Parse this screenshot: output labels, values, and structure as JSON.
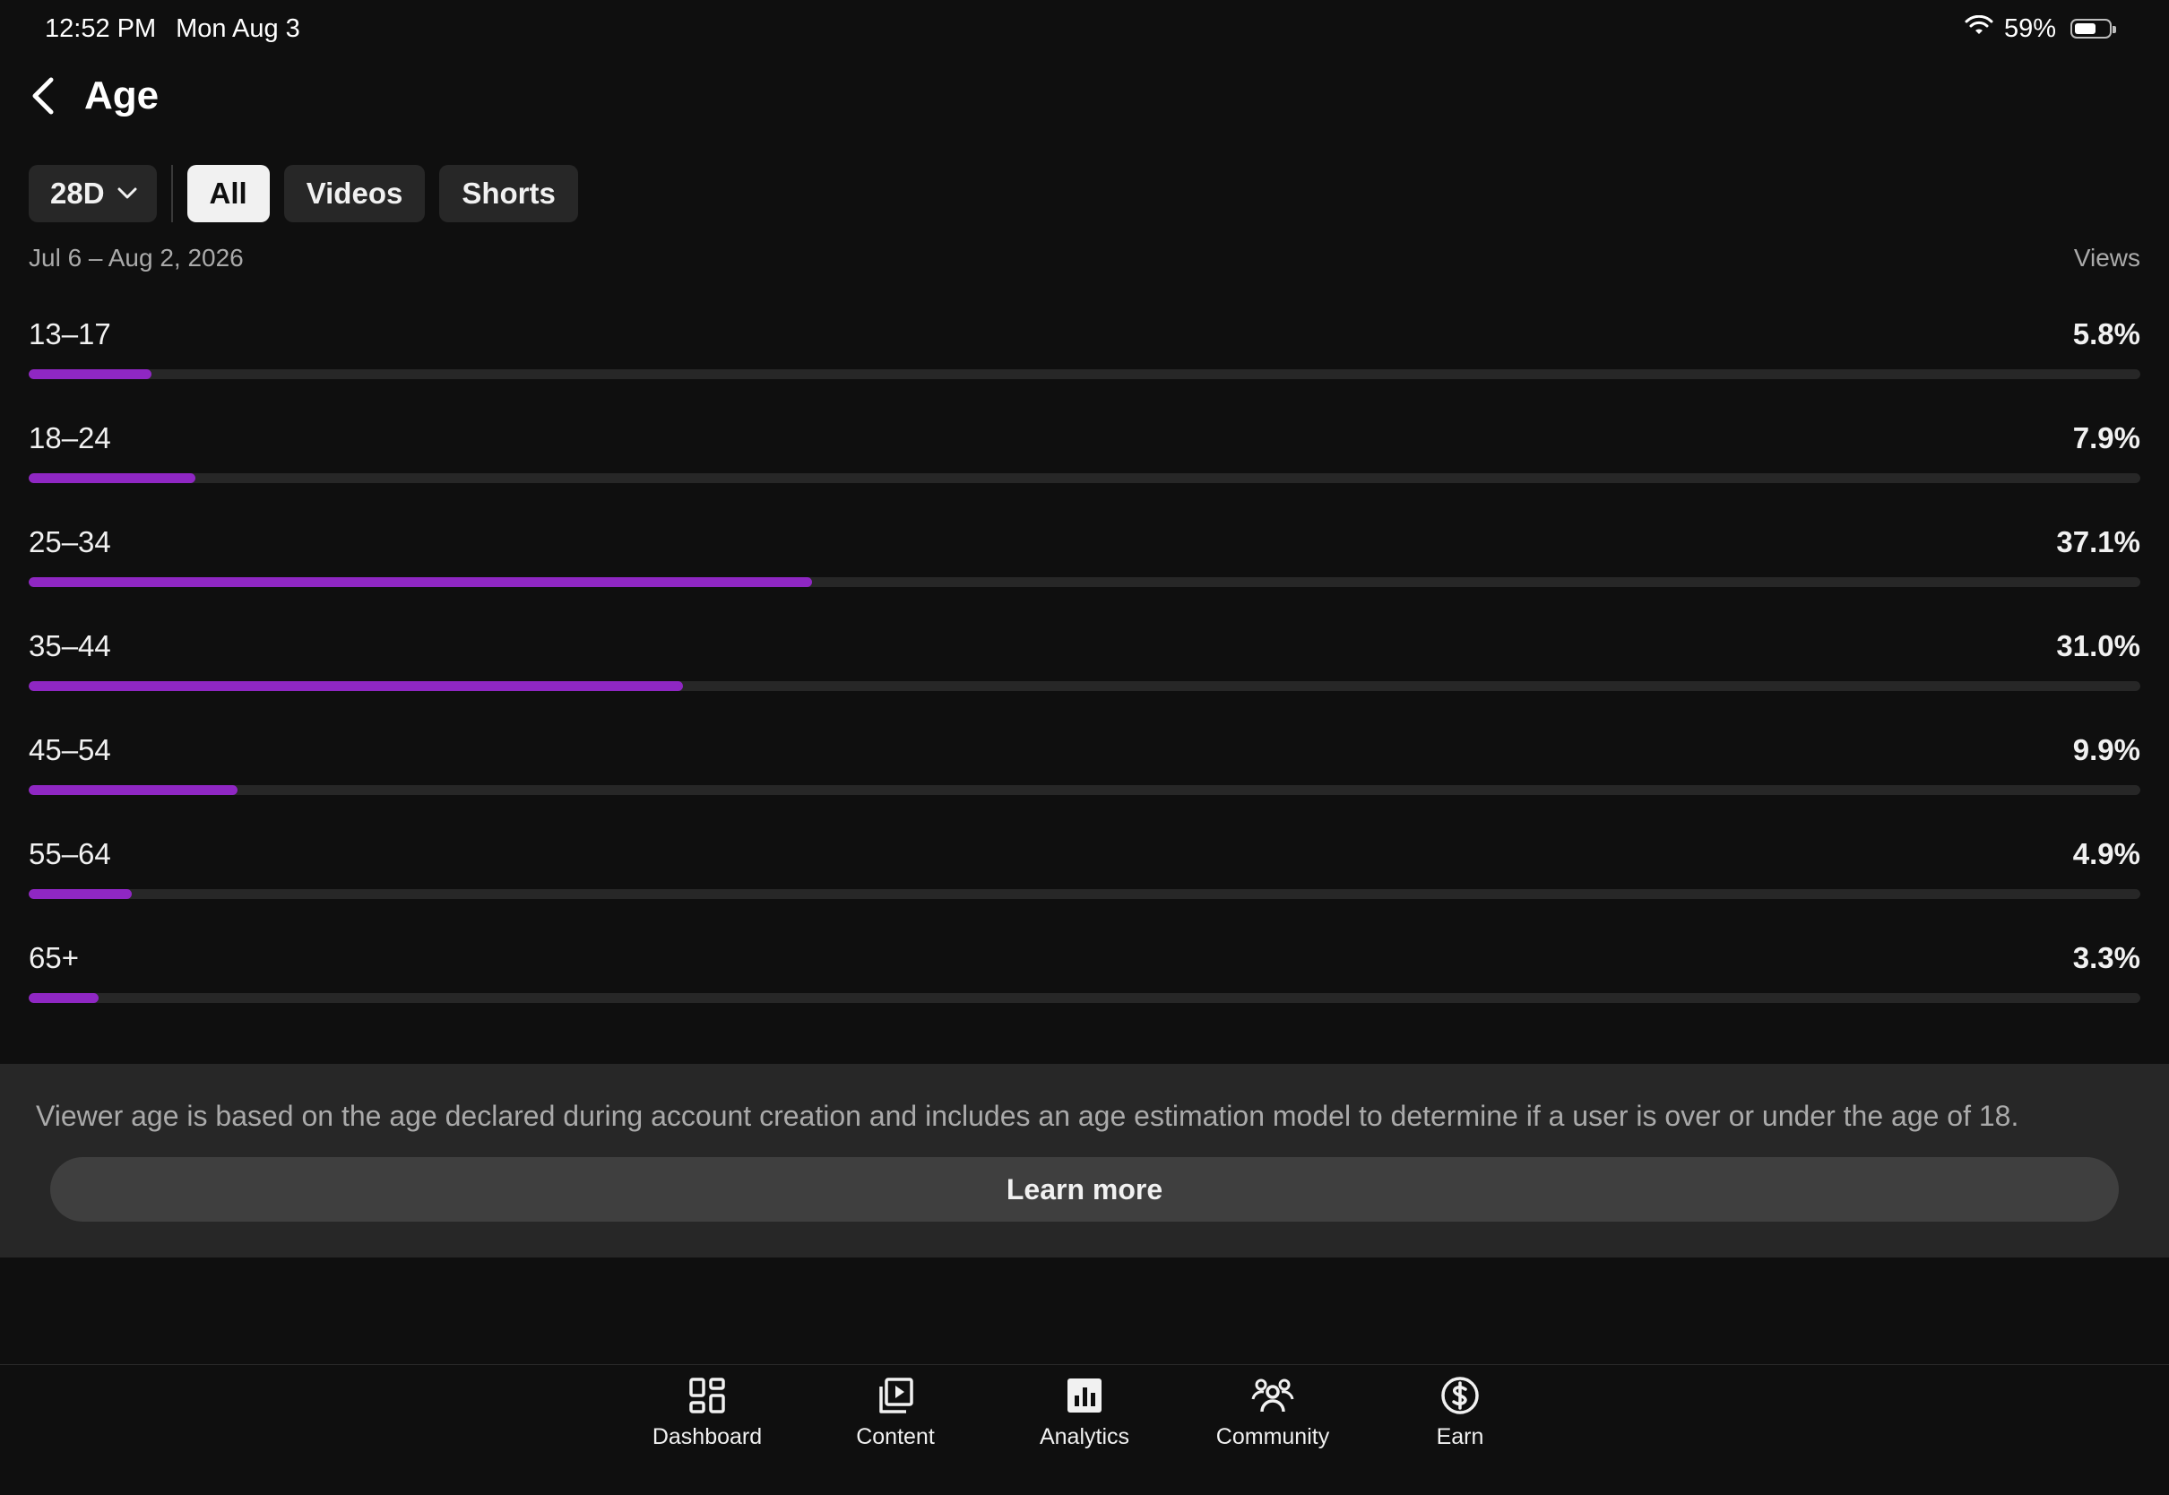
{
  "status_bar": {
    "time": "12:52 PM",
    "date": "Mon Aug 3",
    "battery": "59%"
  },
  "header": {
    "title": "Age"
  },
  "filters": {
    "period": "28D",
    "chips": [
      {
        "label": "All",
        "active": true
      },
      {
        "label": "Videos",
        "active": false
      },
      {
        "label": "Shorts",
        "active": false
      }
    ]
  },
  "date_range": "Jul 6 – Aug 2, 2026",
  "metric": "Views",
  "age_groups": [
    {
      "label": "13–17",
      "value": "5.8%",
      "fraction": 0.058
    },
    {
      "label": "18–24",
      "value": "7.9%",
      "fraction": 0.079
    },
    {
      "label": "25–34",
      "value": "37.1%",
      "fraction": 0.371
    },
    {
      "label": "35–44",
      "value": "31.0%",
      "fraction": 0.31
    },
    {
      "label": "45–54",
      "value": "9.9%",
      "fraction": 0.099
    },
    {
      "label": "55–64",
      "value": "4.9%",
      "fraction": 0.049
    },
    {
      "label": "65+",
      "value": "3.3%",
      "fraction": 0.033
    }
  ],
  "info": {
    "text": "Viewer age is based on the age declared during account creation and includes an age estimation model to determine if a user is over or under the age of 18.",
    "button": "Learn more"
  },
  "nav": [
    {
      "label": "Dashboard",
      "icon": "dashboard-icon"
    },
    {
      "label": "Content",
      "icon": "content-icon"
    },
    {
      "label": "Analytics",
      "icon": "analytics-icon"
    },
    {
      "label": "Community",
      "icon": "community-icon"
    },
    {
      "label": "Earn",
      "icon": "earn-icon"
    }
  ],
  "colors": {
    "accent": "#8f27c3",
    "background": "#0f0f0f",
    "track": "#272727"
  }
}
